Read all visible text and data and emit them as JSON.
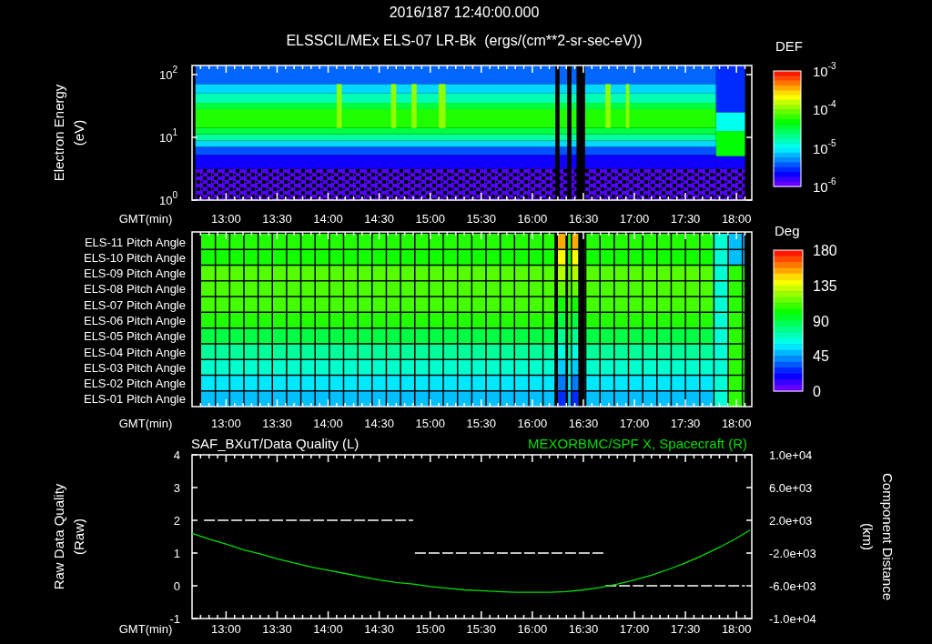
{
  "header": {
    "date_time": "2016/187 12:40:00.000",
    "title": "ELSSCIL/MEx ELS-07 LR-Bk  (ergs/(cm**2-sr-sec-eV))"
  },
  "spectrogram_panel": {
    "y_label": [
      "Electron Energy",
      "(eV)"
    ],
    "y_ticks": [
      {
        "base": "10",
        "exponent": "2"
      },
      {
        "base": "10",
        "exponent": "1"
      },
      {
        "base": "10",
        "exponent": "0"
      }
    ],
    "colorbar": {
      "title": "DEF",
      "ticks": [
        {
          "base": "10",
          "exponent": "-3"
        },
        {
          "base": "10",
          "exponent": "-4"
        },
        {
          "base": "10",
          "exponent": "-5"
        },
        {
          "base": "10",
          "exponent": "-6"
        }
      ]
    },
    "x_label": "GMT(min)",
    "time_labels": [
      "13:00",
      "13:30",
      "14:00",
      "14:30",
      "15:00",
      "15:30",
      "16:00",
      "16:30",
      "17:00",
      "17:30",
      "18:00"
    ]
  },
  "pitch_panel": {
    "rows": [
      {
        "label": "ELS-11 Pitch Angle",
        "color": "#22ff00"
      },
      {
        "label": "ELS-10 Pitch Angle",
        "color": "#11ff00"
      },
      {
        "label": "ELS-09 Pitch Angle",
        "color": "#55ff00"
      },
      {
        "label": "ELS-08 Pitch Angle",
        "color": "#4cff00"
      },
      {
        "label": "ELS-07 Pitch Angle",
        "color": "#44ff00"
      },
      {
        "label": "ELS-06 Pitch Angle",
        "color": "#22ff00"
      },
      {
        "label": "ELS-05 Pitch Angle",
        "color": "#00ff44"
      },
      {
        "label": "ELS-04 Pitch Angle",
        "color": "#00ff99"
      },
      {
        "label": "ELS-03 Pitch Angle",
        "color": "#00ffcc"
      },
      {
        "label": "ELS-02 Pitch Angle",
        "color": "#00e8ff"
      },
      {
        "label": "ELS-01 Pitch Angle",
        "color": "#00c0ff"
      }
    ],
    "colorbar": {
      "title": "Deg",
      "ticks": [
        "180",
        "135",
        "90",
        "45",
        "0"
      ]
    },
    "x_label": "GMT(min)",
    "time_labels": [
      "13:00",
      "13:30",
      "14:00",
      "14:30",
      "15:00",
      "15:30",
      "16:00",
      "16:30",
      "17:00",
      "17:30",
      "18:00"
    ]
  },
  "quality_panel": {
    "left_y_label": [
      "Raw Data Quality",
      "(Raw)"
    ],
    "right_y_label": [
      "Component Distance",
      "(km)"
    ],
    "chart_data": {
      "type": "line",
      "title": "SAF_BXuT/Data Quality (L)",
      "xlabel": "GMT(min)",
      "x": [
        767,
        890,
        891,
        1002,
        1003,
        1085
      ],
      "series": [
        {
          "color": "#ffffff",
          "line_style": "dashed",
          "values": [
            2,
            2,
            null,
            null,
            null,
            null
          ]
        },
        {
          "color": "#ffffff",
          "line_style": "dashed",
          "values": [
            null,
            null,
            1,
            1,
            null,
            null
          ]
        },
        {
          "color": "#ffffff",
          "line_style": "dashed",
          "values": [
            null,
            null,
            null,
            null,
            0,
            0
          ]
        }
      ],
      "xlim": [
        760,
        1089
      ],
      "ylim": [
        -1,
        4
      ],
      "xticks": [
        {
          "value": 780,
          "label": "13:00"
        },
        {
          "value": 810,
          "label": "13:30"
        },
        {
          "value": 840,
          "label": "14:00"
        },
        {
          "value": 870,
          "label": "14:30"
        },
        {
          "value": 900,
          "label": "15:00"
        },
        {
          "value": 930,
          "label": "15:30"
        },
        {
          "value": 960,
          "label": "16:00"
        },
        {
          "value": 990,
          "label": "16:30"
        },
        {
          "value": 1020,
          "label": "17:00"
        },
        {
          "value": 1050,
          "label": "17:30"
        },
        {
          "value": 1080,
          "label": "18:00"
        }
      ],
      "yticks": [
        -1,
        0,
        1,
        2,
        3,
        4
      ]
    },
    "right_chart": {
      "chart_data": {
        "type": "line",
        "title": "MEXORBMC/SPF X, Spacecraft (R)",
        "x": [
          760,
          770,
          780,
          790,
          800,
          810,
          820,
          830,
          840,
          850,
          860,
          870,
          880,
          890,
          900,
          910,
          920,
          930,
          940,
          950,
          960,
          970,
          980,
          990,
          1000,
          1010,
          1020,
          1030,
          1040,
          1050,
          1060,
          1070,
          1080,
          1088
        ],
        "series": [
          {
            "color": "#00dd00",
            "line_style": "solid",
            "values": [
              400,
              -300,
              -900,
              -1600,
              -2100,
              -2700,
              -3200,
              -3700,
              -4100,
              -4500,
              -4900,
              -5300,
              -5600,
              -5800,
              -6100,
              -6300,
              -6500,
              -6600,
              -6700,
              -6800,
              -6800,
              -6800,
              -6700,
              -6500,
              -6200,
              -5800,
              -5300,
              -4700,
              -4000,
              -3200,
              -2300,
              -1300,
              -200,
              800
            ]
          }
        ],
        "xlim": [
          760,
          1089
        ],
        "ylim": [
          -10000,
          10000
        ],
        "yticks": [
          {
            "value": 10000,
            "label": "1.0e+04"
          },
          {
            "value": 6000,
            "label": "6.0e+03"
          },
          {
            "value": 2000,
            "label": "2.0e+03"
          },
          {
            "value": -2000,
            "label": "-2.0e+03"
          },
          {
            "value": -6000,
            "label": "-6.0e+03"
          },
          {
            "value": -10000,
            "label": "-1.0e+04"
          }
        ]
      }
    }
  }
}
